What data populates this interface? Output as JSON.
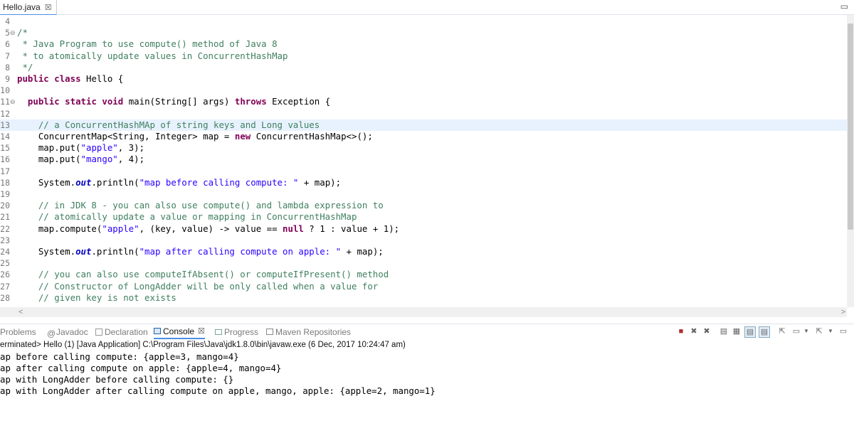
{
  "editor_tab": {
    "title": "Hello.java",
    "close": "☒"
  },
  "code_lines": [
    {
      "n": "4",
      "fold": "",
      "cur": false,
      "tokens": []
    },
    {
      "n": "5",
      "fold": "⊖",
      "cur": false,
      "tokens": [
        {
          "t": "/*",
          "c": "cmt"
        }
      ]
    },
    {
      "n": "6",
      "fold": "",
      "cur": false,
      "tokens": [
        {
          "t": " * Java Program to use compute() method of Java 8",
          "c": "cmt"
        }
      ]
    },
    {
      "n": "7",
      "fold": "",
      "cur": false,
      "tokens": [
        {
          "t": " * to atomically update values in ConcurrentHashMap",
          "c": "cmt"
        }
      ]
    },
    {
      "n": "8",
      "fold": "",
      "cur": false,
      "tokens": [
        {
          "t": " */",
          "c": "cmt"
        }
      ]
    },
    {
      "n": "9",
      "fold": "",
      "cur": false,
      "tokens": [
        {
          "t": "public",
          "c": "kw"
        },
        {
          "t": " ",
          "c": ""
        },
        {
          "t": "class",
          "c": "kw"
        },
        {
          "t": " Hello {",
          "c": ""
        }
      ]
    },
    {
      "n": "10",
      "fold": "",
      "cur": false,
      "tokens": []
    },
    {
      "n": "11",
      "fold": "⊖",
      "cur": false,
      "tokens": [
        {
          "t": "  ",
          "c": ""
        },
        {
          "t": "public",
          "c": "kw"
        },
        {
          "t": " ",
          "c": ""
        },
        {
          "t": "static",
          "c": "kw"
        },
        {
          "t": " ",
          "c": ""
        },
        {
          "t": "void",
          "c": "kw"
        },
        {
          "t": " main(String[] args) ",
          "c": ""
        },
        {
          "t": "throws",
          "c": "kw"
        },
        {
          "t": " Exception {",
          "c": ""
        }
      ]
    },
    {
      "n": "12",
      "fold": "",
      "cur": false,
      "tokens": []
    },
    {
      "n": "13",
      "fold": "",
      "cur": true,
      "tokens": [
        {
          "t": "    // a ConcurrentHashMAp of string keys and Long values",
          "c": "cmt"
        }
      ]
    },
    {
      "n": "14",
      "fold": "",
      "cur": false,
      "tokens": [
        {
          "t": "    ConcurrentMap<String, Integer> map = ",
          "c": ""
        },
        {
          "t": "new",
          "c": "kw"
        },
        {
          "t": " ConcurrentHashMap<>();",
          "c": ""
        }
      ]
    },
    {
      "n": "15",
      "fold": "",
      "cur": false,
      "tokens": [
        {
          "t": "    map.put(",
          "c": ""
        },
        {
          "t": "\"apple\"",
          "c": "str"
        },
        {
          "t": ", 3);",
          "c": ""
        }
      ]
    },
    {
      "n": "16",
      "fold": "",
      "cur": false,
      "tokens": [
        {
          "t": "    map.put(",
          "c": ""
        },
        {
          "t": "\"mango\"",
          "c": "str"
        },
        {
          "t": ", 4);",
          "c": ""
        }
      ]
    },
    {
      "n": "17",
      "fold": "",
      "cur": false,
      "tokens": []
    },
    {
      "n": "18",
      "fold": "",
      "cur": false,
      "tokens": [
        {
          "t": "    System.",
          "c": ""
        },
        {
          "t": "out",
          "c": "fld"
        },
        {
          "t": ".println(",
          "c": ""
        },
        {
          "t": "\"map before calling compute: \"",
          "c": "str"
        },
        {
          "t": " + map);",
          "c": ""
        }
      ]
    },
    {
      "n": "19",
      "fold": "",
      "cur": false,
      "tokens": []
    },
    {
      "n": "20",
      "fold": "",
      "cur": false,
      "tokens": [
        {
          "t": "    // in JDK 8 - you can also use compute() and lambda expression to",
          "c": "cmt"
        }
      ]
    },
    {
      "n": "21",
      "fold": "",
      "cur": false,
      "tokens": [
        {
          "t": "    // atomically update a value or mapping in ConcurrentHashMap",
          "c": "cmt"
        }
      ]
    },
    {
      "n": "22",
      "fold": "",
      "cur": false,
      "tokens": [
        {
          "t": "    map.compute(",
          "c": ""
        },
        {
          "t": "\"apple\"",
          "c": "str"
        },
        {
          "t": ", (key, value) -> value == ",
          "c": ""
        },
        {
          "t": "null",
          "c": "kw"
        },
        {
          "t": " ? 1 : value + 1);",
          "c": ""
        }
      ]
    },
    {
      "n": "23",
      "fold": "",
      "cur": false,
      "tokens": []
    },
    {
      "n": "24",
      "fold": "",
      "cur": false,
      "tokens": [
        {
          "t": "    System.",
          "c": ""
        },
        {
          "t": "out",
          "c": "fld"
        },
        {
          "t": ".println(",
          "c": ""
        },
        {
          "t": "\"map after calling compute on apple: \"",
          "c": "str"
        },
        {
          "t": " + map);",
          "c": ""
        }
      ]
    },
    {
      "n": "25",
      "fold": "",
      "cur": false,
      "tokens": []
    },
    {
      "n": "26",
      "fold": "",
      "cur": false,
      "tokens": [
        {
          "t": "    // you can also use computeIfAbsent() or computeIfPresent() method",
          "c": "cmt"
        }
      ]
    },
    {
      "n": "27",
      "fold": "",
      "cur": false,
      "tokens": [
        {
          "t": "    // Constructor of LongAdder will be only called when a value for",
          "c": "cmt"
        }
      ]
    },
    {
      "n": "28",
      "fold": "",
      "cur": false,
      "tokens": [
        {
          "t": "    // given key is not exists",
          "c": "cmt"
        }
      ]
    }
  ],
  "views": [
    {
      "label": "Problems",
      "icon": "problems-icon",
      "active": false
    },
    {
      "label": "Javadoc",
      "icon": "javadoc-icon",
      "active": false
    },
    {
      "label": "Declaration",
      "icon": "declaration-icon",
      "active": false
    },
    {
      "label": "Console",
      "icon": "console-icon",
      "active": true,
      "close": "☒"
    },
    {
      "label": "Progress",
      "icon": "progress-icon",
      "active": false
    },
    {
      "label": "Maven Repositories",
      "icon": "maven-icon",
      "active": false
    }
  ],
  "console": {
    "header": "erminated> Hello (1) [Java Application] C:\\Program Files\\Java\\jdk1.8.0\\bin\\javaw.exe (6 Dec, 2017 10:24:47 am)",
    "lines": [
      "ap before calling compute: {apple=3, mango=4}",
      "ap after calling compute on apple: {apple=4, mango=4}",
      "ap with LongAdder before calling compute: {}",
      "ap with LongAdder after calling compute on apple, mango, apple: {apple=2, mango=1}"
    ]
  },
  "colors": {
    "comment": "#3f7f5f",
    "keyword": "#7f0055",
    "string": "#2a00ff",
    "field": "#0000c0",
    "current_line": "#e8f2fe",
    "active_tab": "#4a8fe8"
  }
}
